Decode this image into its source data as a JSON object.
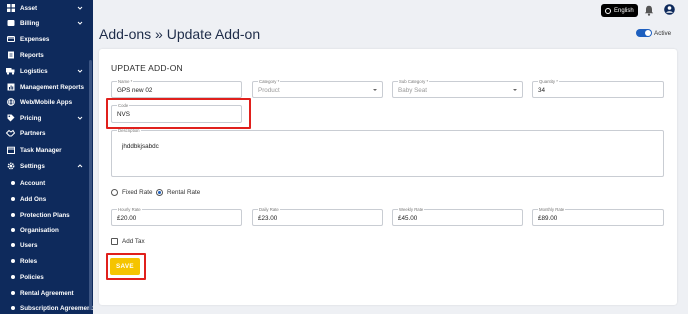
{
  "sidebar": {
    "items": [
      {
        "label": "Asset",
        "icon": "grid-icon",
        "expandable": true
      },
      {
        "label": "Billing",
        "icon": "dollar-icon",
        "expandable": true
      },
      {
        "label": "Expenses",
        "icon": "receipt-icon",
        "expandable": false
      },
      {
        "label": "Reports",
        "icon": "report-icon",
        "expandable": false
      },
      {
        "label": "Logistics",
        "icon": "truck-icon",
        "expandable": true
      },
      {
        "label": "Management Reports",
        "icon": "chart-icon",
        "expandable": false
      },
      {
        "label": "Web/Mobile Apps",
        "icon": "globe-icon",
        "expandable": false
      },
      {
        "label": "Pricing",
        "icon": "tag-icon",
        "expandable": true
      },
      {
        "label": "Partners",
        "icon": "handshake-icon",
        "expandable": false
      },
      {
        "label": "Task Manager",
        "icon": "calendar-icon",
        "expandable": false
      },
      {
        "label": "Settings",
        "icon": "gear-icon",
        "expandable": true,
        "expanded": true
      }
    ],
    "subitems": [
      "Account",
      "Add Ons",
      "Protection Plans",
      "Organisation",
      "Users",
      "Roles",
      "Policies",
      "Rental Agreement",
      "Subscription Agreement"
    ]
  },
  "topbar": {
    "language": "English"
  },
  "page": {
    "title": "Add-ons » Update Add-on",
    "status_label": "Active"
  },
  "form": {
    "heading": "UPDATE ADD-ON",
    "name": {
      "label": "Name *",
      "value": "GPS new 02"
    },
    "category": {
      "label": "Category *",
      "placeholder": "Product"
    },
    "subcategory": {
      "label": "Sub Category *",
      "placeholder": "Baby Seat"
    },
    "quantity": {
      "label": "Quantity *",
      "value": "34"
    },
    "code": {
      "label": "Code",
      "value": "NVS"
    },
    "description": {
      "label": "Description",
      "value": "jhddbkjsabdc"
    },
    "rate_type": {
      "options": [
        "Fixed Rate",
        "Rental Rate"
      ],
      "selected": "Rental Rate"
    },
    "hourly_rate": {
      "label": "Hourly Rate",
      "value": "£20.00"
    },
    "daily_rate": {
      "label": "Daily Rate",
      "value": "£23.00"
    },
    "weekly_rate": {
      "label": "Weekly Rate",
      "value": "£45.00"
    },
    "monthly_rate": {
      "label": "Monthly Rate",
      "value": "£89.00"
    },
    "add_tax": {
      "label": "Add Tax",
      "checked": false
    },
    "save_label": "SAVE"
  },
  "colors": {
    "sidebar_bg": "#0e2a5c",
    "accent": "#1d5fbf",
    "save_button": "#f5c400",
    "highlight": "#e0201c"
  }
}
